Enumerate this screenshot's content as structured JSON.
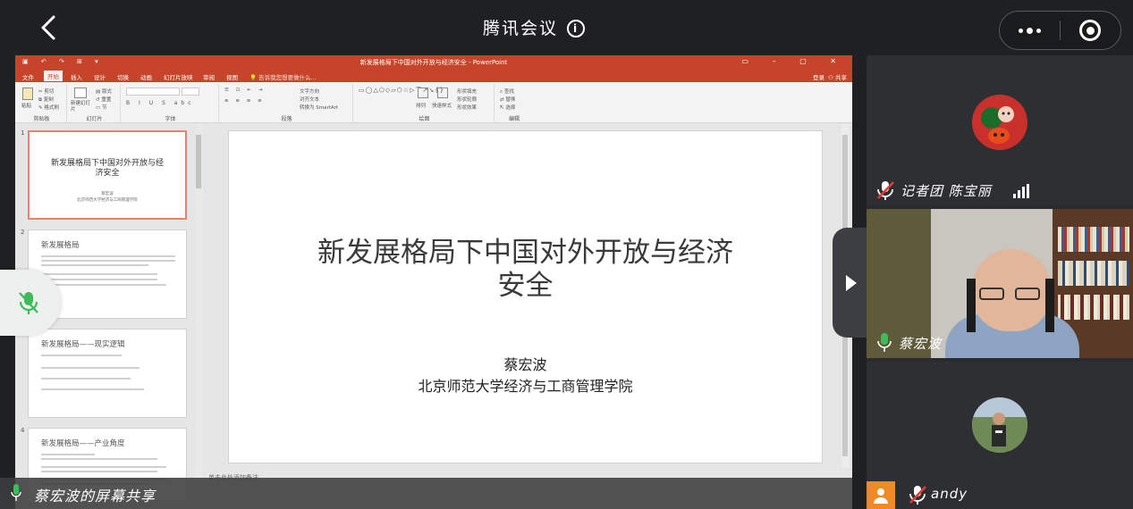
{
  "topbar": {
    "title": "腾讯会议"
  },
  "ppt": {
    "window_title": "新发展格局下中国对外开放与经济安全 - PowerPoint",
    "tabs": [
      "文件",
      "开始",
      "插入",
      "设计",
      "切换",
      "动画",
      "幻灯片放映",
      "审阅",
      "视图"
    ],
    "active_tab": "开始",
    "tell_me": "告诉我您想要做什么...",
    "login": "登录",
    "share": "共享",
    "groups": [
      "剪贴板",
      "幻灯片",
      "字体",
      "段落",
      "绘图",
      "编辑"
    ],
    "ribbon_labels": {
      "paste": "粘贴",
      "cut": "剪切",
      "copy": "复制",
      "format_painter": "格式刷",
      "new_slide": "新建幻灯片",
      "layout": "版式",
      "reset": "重置",
      "section": "节",
      "text_direction": "文字方向",
      "align_text": "对齐文本",
      "smartart": "转换为 SmartArt",
      "arrange": "排列",
      "quick_styles": "快速样式",
      "shape_fill": "形状填充",
      "shape_outline": "形状轮廓",
      "shape_effects": "形状效果",
      "find": "查找",
      "replace": "替换",
      "select": "选择"
    },
    "thumbnails": [
      {
        "num": "1",
        "title": "新发展格局下中国对外开放与经济安全",
        "author": "蔡宏波",
        "inst": "北京师范大学经济与工商管理学院"
      },
      {
        "num": "2",
        "title": "新发展格局"
      },
      {
        "num": "3",
        "title": "新发展格局——现实逻辑"
      },
      {
        "num": "4",
        "title": "新发展格局——产业角度"
      }
    ],
    "slide": {
      "title": "新发展格局下中国对外开放与经济安全",
      "author": "蔡宏波",
      "institution": "北京师范大学经济与工商管理学院"
    },
    "notes_placeholder": "单击此处添加备注"
  },
  "share_label": "蔡宏波的屏幕共享",
  "participants": [
    {
      "name": "记者团 陈宝丽",
      "muted": true
    },
    {
      "name": "蔡宏波",
      "muted": false
    },
    {
      "name": "andy",
      "muted": true
    }
  ],
  "colors": {
    "ppt_accent": "#c6452a",
    "mic_green": "#3dbd5a",
    "mute_red": "#e53935",
    "bg": "#1f2023"
  }
}
